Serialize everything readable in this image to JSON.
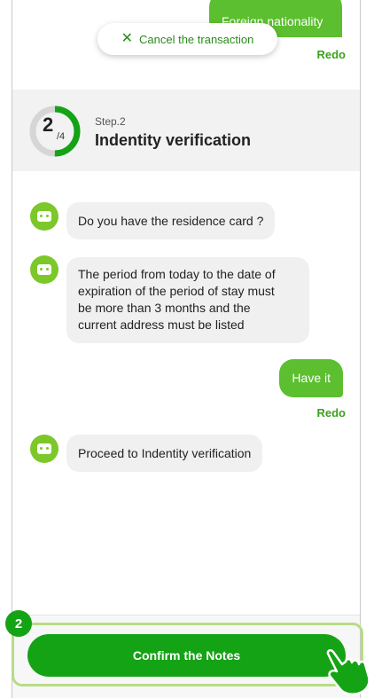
{
  "header": {
    "previous_answer": "Foreign nationality",
    "redo_top": "Redo",
    "cancel_label": "Cancel the transaction"
  },
  "step": {
    "current": "2",
    "total": "/4",
    "label": "Step.2",
    "title": "Indentity verification",
    "progress_fraction": 0.5
  },
  "chat": {
    "bot_q1": "Do you have the residence card ?",
    "bot_note_lines": [
      "The period from today to the date of",
      "expiration of the period of stay must",
      "be more than 3 months and the",
      "current address must be listed"
    ],
    "user_answer": "Have it",
    "redo_answer": "Redo",
    "bot_proceed": "Proceed to Indentity verification"
  },
  "footer": {
    "confirm_label": "Confirm the Notes",
    "badge_number": "2"
  },
  "colors": {
    "accent_green": "#14a314",
    "bubble_green": "#5bbf2f",
    "highlight": "#b8dc85"
  }
}
